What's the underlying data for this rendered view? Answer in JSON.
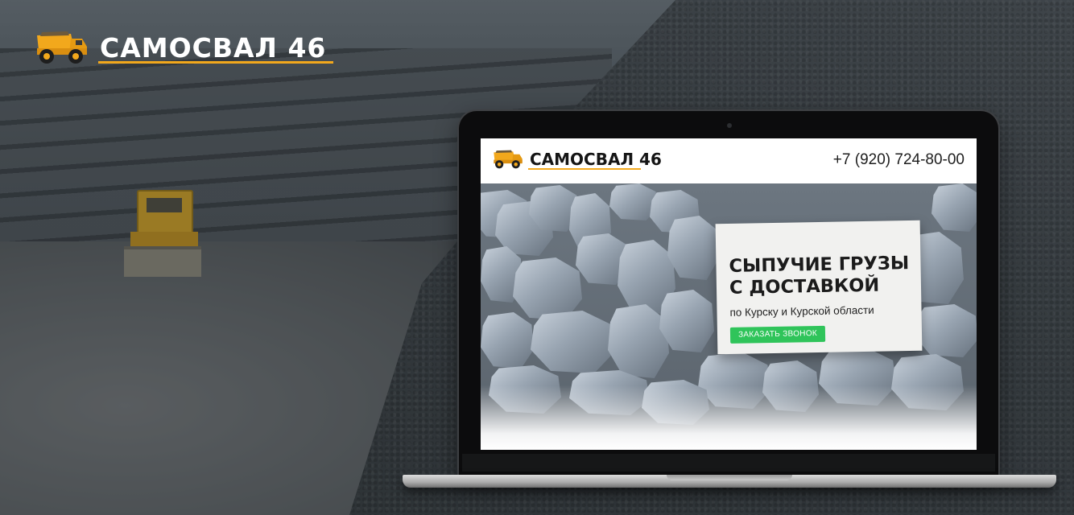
{
  "brand": {
    "name": "САМОСВАЛ 46",
    "accent_color": "#f2a81c",
    "logo_icon": "dump-truck-icon"
  },
  "site": {
    "logo_name": "САМОСВАЛ 46",
    "phone": "+7 (920) 724-80-00",
    "hero": {
      "title_line1": "СЫПУЧИЕ ГРУЗЫ",
      "title_line2": "С ДОСТАВКОЙ",
      "subtitle": "по Курску и Курской области",
      "cta_label": "ЗАКАЗАТЬ ЗВОНОК",
      "cta_color": "#2fc45a"
    }
  }
}
